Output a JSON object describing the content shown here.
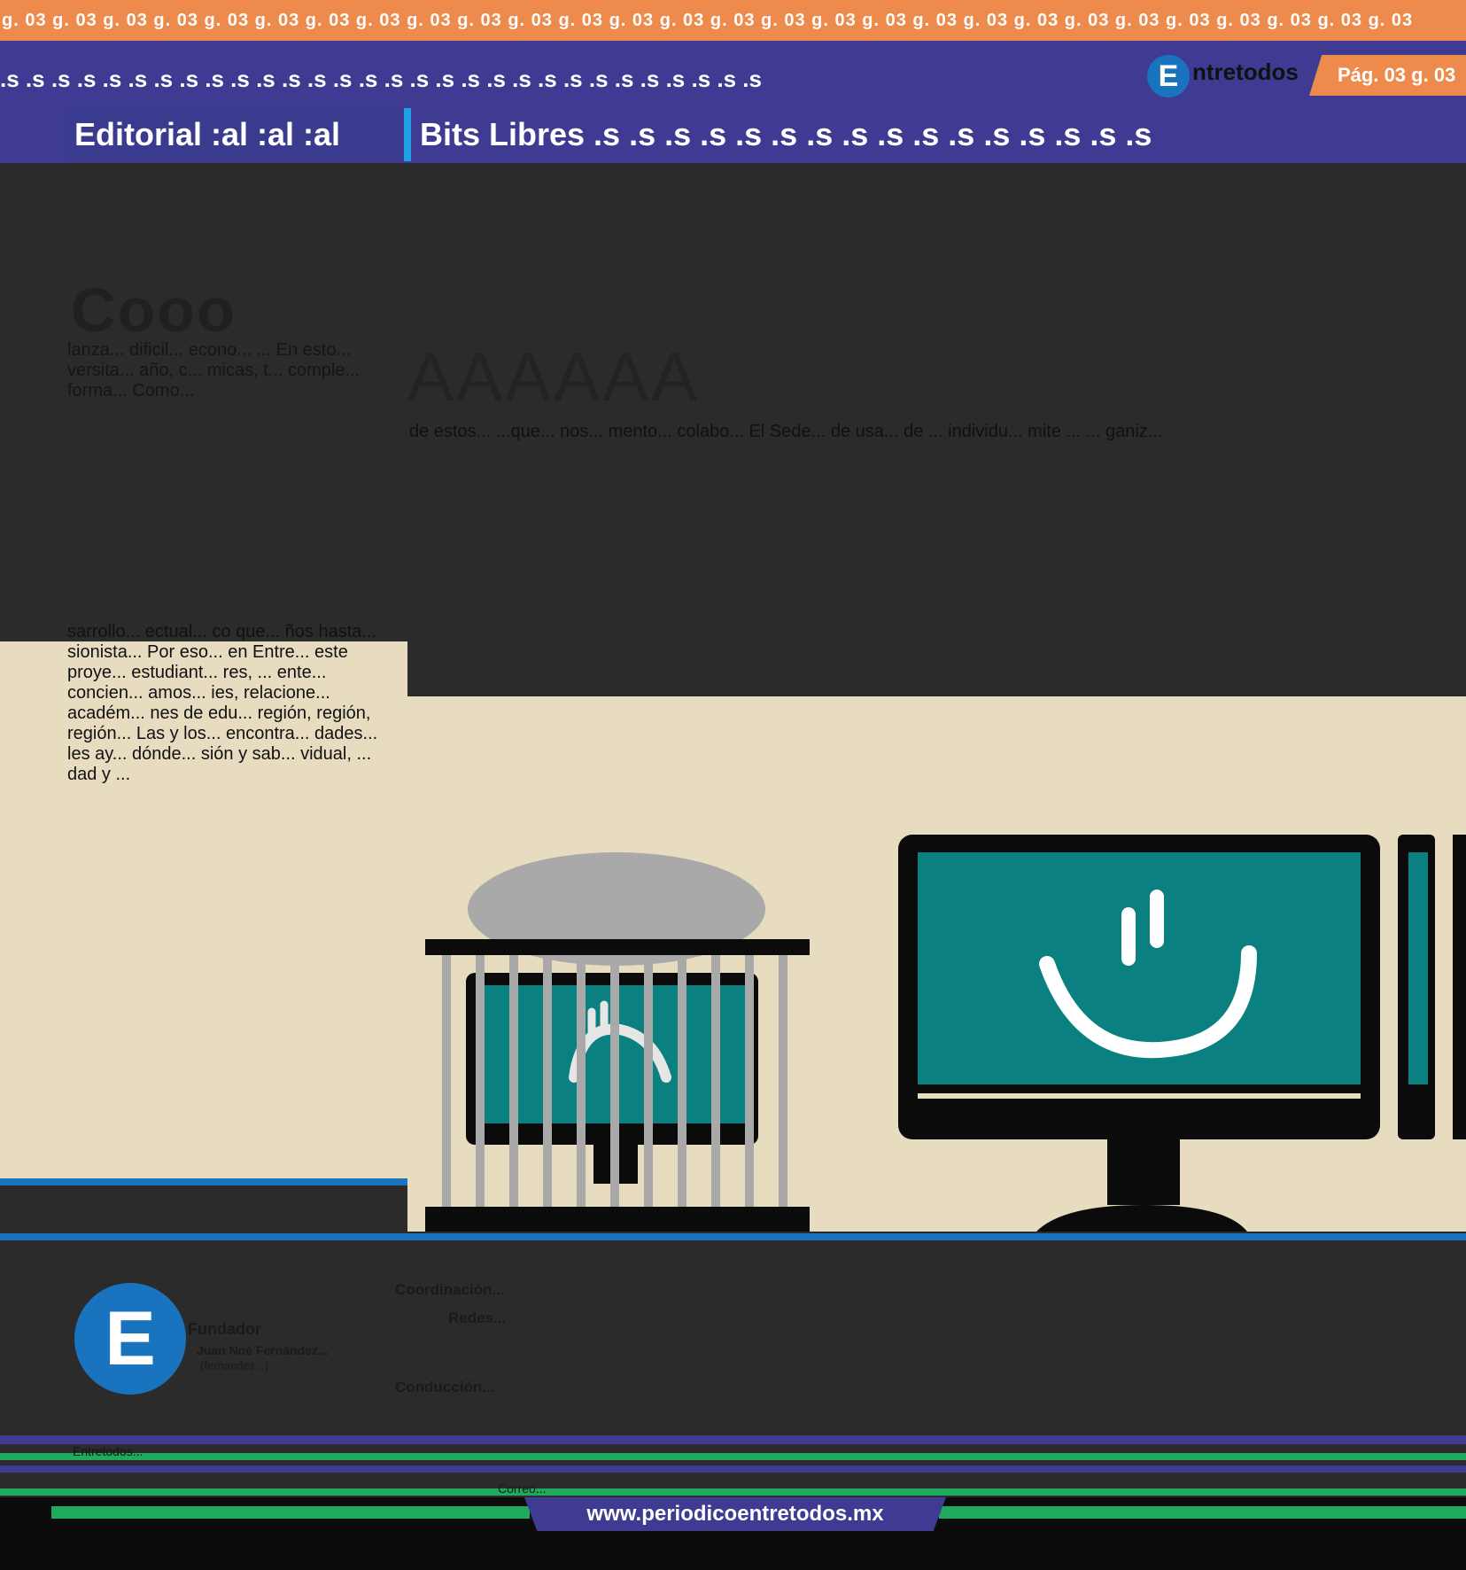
{
  "header": {
    "page_label_repeat": "g. 03 g. 03 g. 03 g. 03 g. 03 g. 03 g. 03 g. 03 g. 03 g. 03 g. 03 g. 03 g. 03 g. 03 g. 03 g. 03 g. 03 g. 03 g. 03 g. 03 g. 03 g. 03 g. 03 g. 03 g. 03 g. 03 g. 03 g. 03",
    "date_repeat": ".s .s .s .s .s .s .s .s .s .s .s .s .s .s .s .s .s .s .s .s .s .s .s .s .s .s .s .s .s .s",
    "logo_letter": "E",
    "brand": "ntretodos",
    "page_badge": "Pág. 03 g. 03"
  },
  "sections": {
    "editorial": "Editorial :al :al :al",
    "bits_libres": "Bits Libres .s .s .s .s .s .s .s .s .s .s .s .s .s .s .s .s"
  },
  "article": {
    "headline": "Cooo",
    "subhead": "AAAAAA",
    "left_top_text": "lanza... dificil... econo... ... En esto... versita... año, c... micas, t... comple... forma... Como...",
    "left_bottom_text": "sarrollo... ectual... co que... ños hasta... sionista... Por eso... en Entre... este proye... estudiant... res, ... ente... concien... amos... ies, relacione... académ... nes de edu... región, región, región... Las y los... encontra... dades... les ay... dónde... sión y sab... vidual, ... dad y ...",
    "main_text": "de estos... ...que... nos... mento... colabo... El Sede... de usa... de ... individu... mite ... ... ganiz..."
  },
  "masthead": {
    "logo_letter": "E",
    "coordinacion": "Coordinación...",
    "redes": "Redes...",
    "fundador": "Fundador",
    "fundador_name": "Juan Noé Fernández...",
    "fundador_email": "(fernandez...)",
    "conduccion": "Conducción..."
  },
  "footer": {
    "legal": "Entretodos...",
    "contact": "Correo...",
    "website": "www.periodicoentretodos.mx"
  },
  "colors": {
    "orange": "#ee8a4b",
    "purple": "#3f3b92",
    "blue": "#1a73bf",
    "cyan": "#1ea1e6",
    "teal": "#0b8080",
    "beige": "#e7dcc0",
    "green": "#1faa5e"
  },
  "icons": [
    "caged-monitor-sad-icon",
    "monitor-smile-icon"
  ]
}
